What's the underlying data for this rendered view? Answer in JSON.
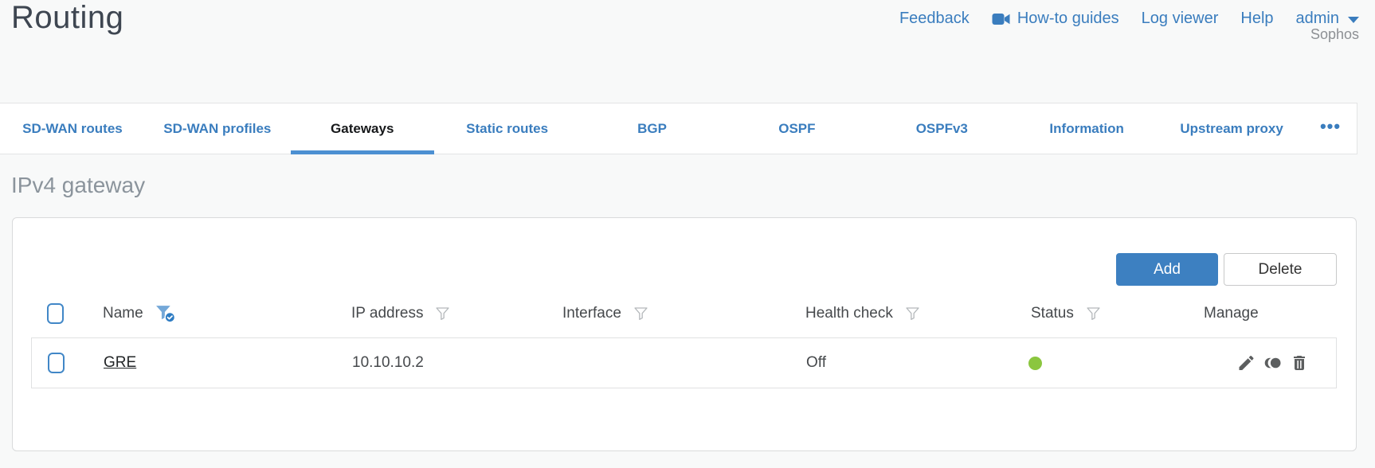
{
  "header": {
    "title": "Routing",
    "feedback": "Feedback",
    "howto_guides": "How-to guides",
    "log_viewer": "Log viewer",
    "help": "Help",
    "user": "admin",
    "brand": "Sophos"
  },
  "tabs": {
    "active": "Gateways",
    "items": [
      {
        "label": "SD-WAN routes"
      },
      {
        "label": "SD-WAN profiles"
      },
      {
        "label": "Gateways"
      },
      {
        "label": "Static routes"
      },
      {
        "label": "BGP"
      },
      {
        "label": "OSPF"
      },
      {
        "label": "OSPFv3"
      },
      {
        "label": "Information"
      },
      {
        "label": "Upstream proxy"
      }
    ],
    "overflow_label": "•••"
  },
  "main": {
    "section_title": "IPv4 gateway",
    "buttons": {
      "add": "Add",
      "delete": "Delete"
    },
    "table": {
      "columns": [
        {
          "label": "Name",
          "filter": "active"
        },
        {
          "label": "IP address",
          "filter": "default"
        },
        {
          "label": "Interface",
          "filter": "default"
        },
        {
          "label": "Health check",
          "filter": "default"
        },
        {
          "label": "Status",
          "filter": "default"
        },
        {
          "label": "Manage",
          "filter": "none"
        }
      ],
      "rows": [
        {
          "name": "GRE",
          "ip_address": "10.10.10.2",
          "interface": "",
          "health_check": "Off",
          "status": "up"
        }
      ]
    }
  },
  "colors": {
    "accent_blue": "#3a7dbe",
    "active_tab_underline": "#4c90d2",
    "add_button_blue": "#3d80c1",
    "status_green": "#8bc63f"
  }
}
